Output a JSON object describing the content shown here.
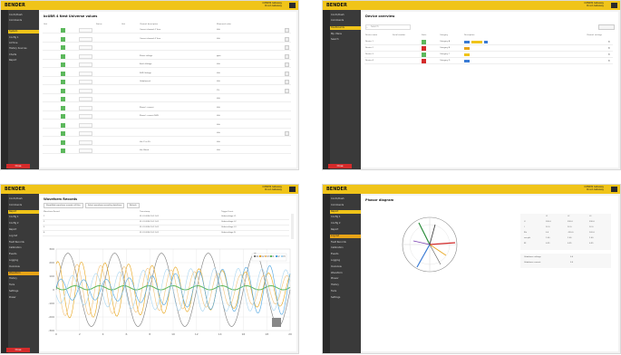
{
  "brand": "BENDER",
  "device_name": "CONDIS Gateway",
  "device_sub": "Cloud-Gateway",
  "p1": {
    "title": "bcUBR 4 Nest Universe values",
    "headers": [
      "Unit",
      "",
      "Status",
      "Unit",
      "Channel description",
      "Measured value"
    ],
    "rows": [
      "a",
      "b",
      "c",
      "d",
      "e",
      "f",
      "g",
      "h",
      "i",
      "j",
      "k",
      "l",
      "m",
      "n",
      "o",
      "p"
    ],
    "descriptions": [
      "Current channel-1 Vcm",
      "Current channel-2 Vcm",
      "",
      "Phase voltage",
      "Earth Voltage",
      "N-PE Voltage",
      "Unbalanced",
      "",
      "",
      "Phase L current",
      "Phase L current N-PE",
      "",
      "",
      "Var. P vs SS",
      "Var. Bleed"
    ],
    "values": [
      "Volt",
      "Volt",
      "",
      "ppm",
      "Volt",
      "Volt",
      "Volt",
      "1%",
      "Volt",
      "Volt",
      "Volt",
      "Volt",
      "Volt",
      "Volt",
      "Volt"
    ],
    "nav": [
      "Contr./Dash",
      "Commands",
      "System",
      "Config 1",
      "Archive",
      "History Sources",
      "Charts",
      "Report"
    ],
    "stop": "Close"
  },
  "p2": {
    "title": "Device overview",
    "search": "Search",
    "headers": [
      "Device name",
      "Serial number",
      "State",
      "Category",
      "Description",
      "Channel settings"
    ],
    "rows": [
      {
        "name": "Device 1",
        "state": "green",
        "cat": "Category A"
      },
      {
        "name": "Device 2",
        "state": "red",
        "cat": "Category B"
      },
      {
        "name": "Device 3",
        "state": "green",
        "cat": "Category C"
      },
      {
        "name": "Device 4",
        "state": "red",
        "cat": "Category D"
      }
    ],
    "nav": [
      "Contr./Dash",
      "Commands",
      "Dashboards",
      "Mp. Menu",
      "Search"
    ],
    "stop": "Close"
  },
  "p3": {
    "title": "Waveform Records",
    "buttons": [
      "Show/Hide waveform records, all files",
      "Select waveform record by date/time",
      "Refresh"
    ],
    "table_headers": [
      "Waveform Record",
      "Timestamp",
      "Trigger Event"
    ],
    "table_rows": [
      [
        "1",
        "01.01.2024 10:11:01",
        "Undervoltage L1"
      ],
      [
        "2",
        "01.01.2024 10:11:01",
        "Undervoltage L2"
      ],
      [
        "3",
        "01.01.2024 10:11:01",
        "Undervoltage L3"
      ],
      [
        "4",
        "01.01.2024 10:11:01",
        "Undervoltage N"
      ]
    ],
    "nav": [
      "Contr./Dash",
      "Commands",
      "Report",
      "Config 1",
      "Config 2",
      "Report",
      "Log list",
      "Fault Records",
      "Calibration",
      "Events",
      "Logging",
      "Overview",
      "Waveform",
      "History",
      "Tools",
      "Settings",
      "Power"
    ],
    "x_ticks": [
      "0",
      "2",
      "4",
      "6",
      "8",
      "10",
      "12",
      "14",
      "16",
      "18",
      "20"
    ],
    "y_ticks": [
      "300",
      "200",
      "100",
      "0",
      "-100",
      "-200",
      "-300"
    ],
    "legend": [
      "U1",
      "U2",
      "U3",
      "I1",
      "I2",
      "I3"
    ],
    "stop": "Close",
    "chart_data": {
      "type": "line",
      "x": [
        0,
        2,
        4,
        6,
        8,
        10,
        12,
        14,
        16,
        18,
        20
      ],
      "series": [
        {
          "name": "U1",
          "color": "#7a7a7a"
        },
        {
          "name": "U2",
          "color": "#e8a417"
        },
        {
          "name": "U3",
          "color": "#f1c27a"
        },
        {
          "name": "I1",
          "color": "#5cb85c"
        },
        {
          "name": "I2",
          "color": "#4aa3df"
        },
        {
          "name": "I3",
          "color": "#a8d5f0"
        }
      ]
    }
  },
  "p4": {
    "title": "Phasor diagram",
    "table_headers": [
      "",
      "L1",
      "L2",
      "L3"
    ],
    "table_rows": [
      [
        "U",
        "230.0",
        "230.0",
        "230.0"
      ],
      [
        "I",
        "12.0",
        "12.0",
        "12.0"
      ],
      [
        "Phi",
        "0.0",
        "-120.0",
        "120.0"
      ],
      [
        "cos phi",
        "1.00",
        "1.00",
        "1.00"
      ],
      [
        "PF",
        "0.99",
        "0.99",
        "0.99"
      ]
    ],
    "summary": [
      [
        "Unbalance voltage",
        "0.0"
      ],
      [
        "Unbalance current",
        "0.0"
      ]
    ],
    "nav": [
      "Contr./Dash",
      "Commands",
      "Report",
      "Config 1",
      "Config 2",
      "Report",
      "Log list",
      "Fault Records",
      "Calibration",
      "Events",
      "Logging",
      "Overview",
      "Waveform",
      "Phasor",
      "History",
      "Tools",
      "Settings"
    ],
    "stop": "Close"
  }
}
